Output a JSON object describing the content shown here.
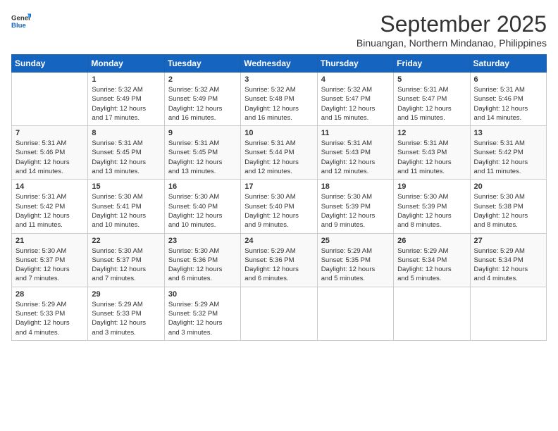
{
  "logo": {
    "general": "General",
    "blue": "Blue"
  },
  "title": "September 2025",
  "subtitle": "Binuangan, Northern Mindanao, Philippines",
  "days_of_week": [
    "Sunday",
    "Monday",
    "Tuesday",
    "Wednesday",
    "Thursday",
    "Friday",
    "Saturday"
  ],
  "weeks": [
    [
      {
        "day": "",
        "info": ""
      },
      {
        "day": "1",
        "info": "Sunrise: 5:32 AM\nSunset: 5:49 PM\nDaylight: 12 hours\nand 17 minutes."
      },
      {
        "day": "2",
        "info": "Sunrise: 5:32 AM\nSunset: 5:49 PM\nDaylight: 12 hours\nand 16 minutes."
      },
      {
        "day": "3",
        "info": "Sunrise: 5:32 AM\nSunset: 5:48 PM\nDaylight: 12 hours\nand 16 minutes."
      },
      {
        "day": "4",
        "info": "Sunrise: 5:32 AM\nSunset: 5:47 PM\nDaylight: 12 hours\nand 15 minutes."
      },
      {
        "day": "5",
        "info": "Sunrise: 5:31 AM\nSunset: 5:47 PM\nDaylight: 12 hours\nand 15 minutes."
      },
      {
        "day": "6",
        "info": "Sunrise: 5:31 AM\nSunset: 5:46 PM\nDaylight: 12 hours\nand 14 minutes."
      }
    ],
    [
      {
        "day": "7",
        "info": "Sunrise: 5:31 AM\nSunset: 5:46 PM\nDaylight: 12 hours\nand 14 minutes."
      },
      {
        "day": "8",
        "info": "Sunrise: 5:31 AM\nSunset: 5:45 PM\nDaylight: 12 hours\nand 13 minutes."
      },
      {
        "day": "9",
        "info": "Sunrise: 5:31 AM\nSunset: 5:45 PM\nDaylight: 12 hours\nand 13 minutes."
      },
      {
        "day": "10",
        "info": "Sunrise: 5:31 AM\nSunset: 5:44 PM\nDaylight: 12 hours\nand 12 minutes."
      },
      {
        "day": "11",
        "info": "Sunrise: 5:31 AM\nSunset: 5:43 PM\nDaylight: 12 hours\nand 12 minutes."
      },
      {
        "day": "12",
        "info": "Sunrise: 5:31 AM\nSunset: 5:43 PM\nDaylight: 12 hours\nand 11 minutes."
      },
      {
        "day": "13",
        "info": "Sunrise: 5:31 AM\nSunset: 5:42 PM\nDaylight: 12 hours\nand 11 minutes."
      }
    ],
    [
      {
        "day": "14",
        "info": "Sunrise: 5:31 AM\nSunset: 5:42 PM\nDaylight: 12 hours\nand 11 minutes."
      },
      {
        "day": "15",
        "info": "Sunrise: 5:30 AM\nSunset: 5:41 PM\nDaylight: 12 hours\nand 10 minutes."
      },
      {
        "day": "16",
        "info": "Sunrise: 5:30 AM\nSunset: 5:40 PM\nDaylight: 12 hours\nand 10 minutes."
      },
      {
        "day": "17",
        "info": "Sunrise: 5:30 AM\nSunset: 5:40 PM\nDaylight: 12 hours\nand 9 minutes."
      },
      {
        "day": "18",
        "info": "Sunrise: 5:30 AM\nSunset: 5:39 PM\nDaylight: 12 hours\nand 9 minutes."
      },
      {
        "day": "19",
        "info": "Sunrise: 5:30 AM\nSunset: 5:39 PM\nDaylight: 12 hours\nand 8 minutes."
      },
      {
        "day": "20",
        "info": "Sunrise: 5:30 AM\nSunset: 5:38 PM\nDaylight: 12 hours\nand 8 minutes."
      }
    ],
    [
      {
        "day": "21",
        "info": "Sunrise: 5:30 AM\nSunset: 5:37 PM\nDaylight: 12 hours\nand 7 minutes."
      },
      {
        "day": "22",
        "info": "Sunrise: 5:30 AM\nSunset: 5:37 PM\nDaylight: 12 hours\nand 7 minutes."
      },
      {
        "day": "23",
        "info": "Sunrise: 5:30 AM\nSunset: 5:36 PM\nDaylight: 12 hours\nand 6 minutes."
      },
      {
        "day": "24",
        "info": "Sunrise: 5:29 AM\nSunset: 5:36 PM\nDaylight: 12 hours\nand 6 minutes."
      },
      {
        "day": "25",
        "info": "Sunrise: 5:29 AM\nSunset: 5:35 PM\nDaylight: 12 hours\nand 5 minutes."
      },
      {
        "day": "26",
        "info": "Sunrise: 5:29 AM\nSunset: 5:34 PM\nDaylight: 12 hours\nand 5 minutes."
      },
      {
        "day": "27",
        "info": "Sunrise: 5:29 AM\nSunset: 5:34 PM\nDaylight: 12 hours\nand 4 minutes."
      }
    ],
    [
      {
        "day": "28",
        "info": "Sunrise: 5:29 AM\nSunset: 5:33 PM\nDaylight: 12 hours\nand 4 minutes."
      },
      {
        "day": "29",
        "info": "Sunrise: 5:29 AM\nSunset: 5:33 PM\nDaylight: 12 hours\nand 3 minutes."
      },
      {
        "day": "30",
        "info": "Sunrise: 5:29 AM\nSunset: 5:32 PM\nDaylight: 12 hours\nand 3 minutes."
      },
      {
        "day": "",
        "info": ""
      },
      {
        "day": "",
        "info": ""
      },
      {
        "day": "",
        "info": ""
      },
      {
        "day": "",
        "info": ""
      }
    ]
  ]
}
